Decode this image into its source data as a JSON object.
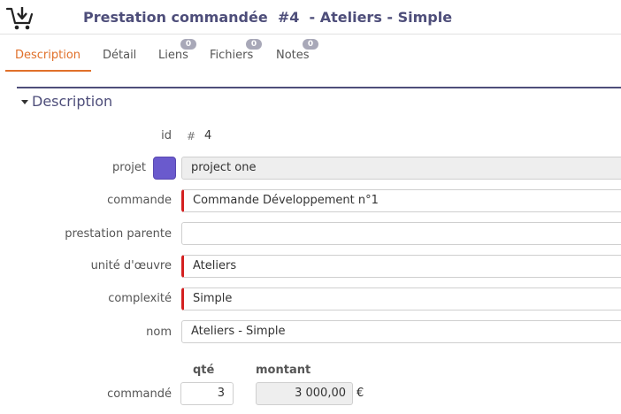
{
  "header": {
    "icon": "cart-download-icon",
    "title": "Prestation commandée  #4  - Ateliers - Simple"
  },
  "tabs": [
    {
      "label": "Description",
      "active": true
    },
    {
      "label": "Détail",
      "active": false
    },
    {
      "label": "Liens",
      "badge": "0",
      "active": false
    },
    {
      "label": "Fichiers",
      "badge": "0",
      "active": false
    },
    {
      "label": "Notes",
      "badge": "0",
      "active": false
    }
  ],
  "section": {
    "title": "Description",
    "icon": "caret-down-icon"
  },
  "form": {
    "id": {
      "label": "id",
      "hash": "#",
      "value": "4"
    },
    "projet": {
      "label": "projet",
      "value": "project one",
      "color": "#6a5acd"
    },
    "commande": {
      "label": "commande",
      "value": "Commande Développement n°1"
    },
    "prestation_parente": {
      "label": "prestation parente",
      "value": ""
    },
    "unite_oeuvre": {
      "label": "unité d'œuvre",
      "value": "Ateliers"
    },
    "complexite": {
      "label": "complexité",
      "value": "Simple"
    },
    "nom": {
      "label": "nom",
      "value": "Ateliers - Simple"
    },
    "quantities": {
      "qty_header": "qté",
      "amount_header": "montant",
      "row_label": "commandé",
      "qty": "3",
      "amount": "3 000,00",
      "currency": "€"
    }
  },
  "colors": {
    "accent": "#e0702a",
    "title": "#4e4e7a",
    "required": "#d42020"
  }
}
